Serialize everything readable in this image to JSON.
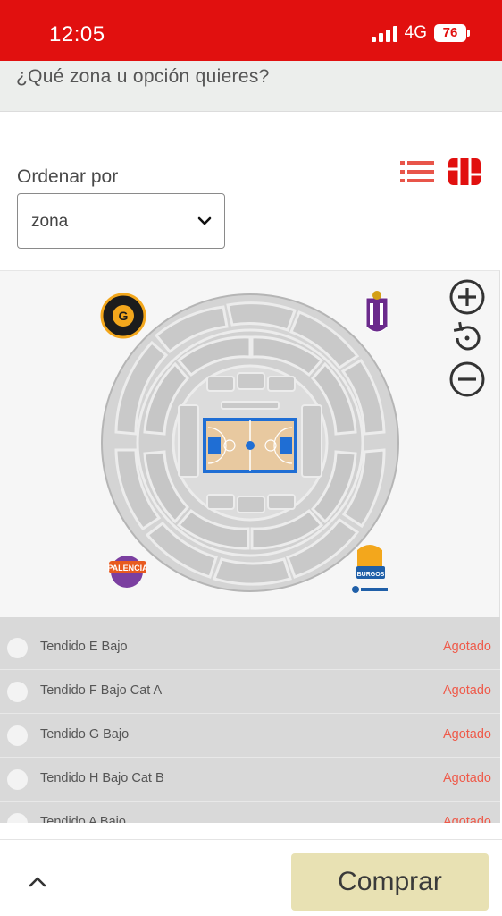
{
  "status_bar": {
    "time": "12:05",
    "network": "4G",
    "battery": "76"
  },
  "header": {
    "question": "¿Qué zona u opción quieres?"
  },
  "sort": {
    "label": "Ordenar por",
    "selected": "zona"
  },
  "view_toggle": {
    "list_icon": "list-icon",
    "map_icon": "map-icon"
  },
  "map": {
    "zoom_in_icon": "plus-circle-icon",
    "reset_icon": "rotate-icon",
    "zoom_out_icon": "minus-circle-icon",
    "logos": [
      "Gipuzkoa Basket",
      "Real Valladolid",
      "Palencia",
      "Burgos"
    ],
    "logo_texts": {
      "palencia": "PALENCIA",
      "burgos": "BURGOS"
    }
  },
  "zones": [
    {
      "name": "Tendido E Bajo",
      "status": "Agotado"
    },
    {
      "name": "Tendido F Bajo Cat A",
      "status": "Agotado"
    },
    {
      "name": "Tendido G Bajo",
      "status": "Agotado"
    },
    {
      "name": "Tendido H Bajo Cat B",
      "status": "Agotado"
    },
    {
      "name": "Tendido A Bajo",
      "status": "Agotado"
    }
  ],
  "footer": {
    "buy_label": "Comprar"
  },
  "colors": {
    "brand_red": "#e1100f",
    "sold_out": "#ef5a4a",
    "buy_button": "#e8e1b3",
    "court_blue": "#1f6ed4",
    "court_wood": "#e8c9a0"
  }
}
